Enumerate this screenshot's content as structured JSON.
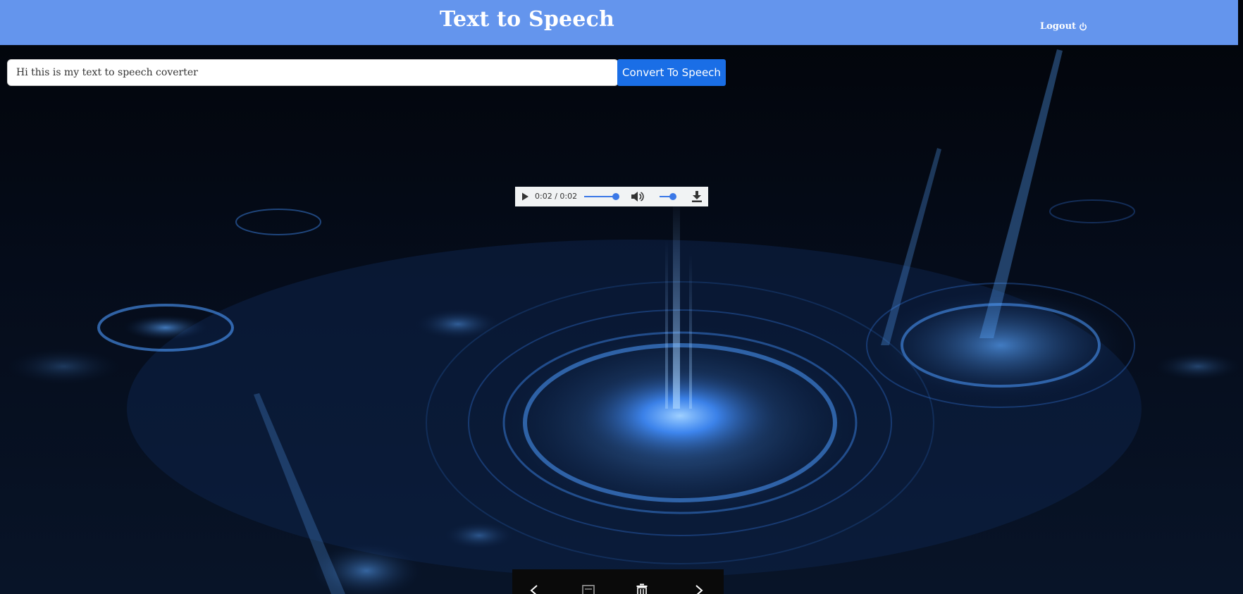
{
  "header": {
    "title": "Text to Speech",
    "logout_label": "Logout",
    "background_color": "#6495ed"
  },
  "input": {
    "value": "Hi this is my text to speech coverter"
  },
  "convert_button": {
    "label": "Convert To Speech",
    "color": "#1a6ee6"
  },
  "audio": {
    "time_display": "0:02 / 0:02",
    "progress": 1.0,
    "volume": 1.0,
    "accent_color": "#3b78e7"
  },
  "bottom_toolbar": {
    "icons": [
      "chevron-left-icon",
      "image-icon",
      "trash-icon",
      "chevron-right-icon"
    ]
  }
}
